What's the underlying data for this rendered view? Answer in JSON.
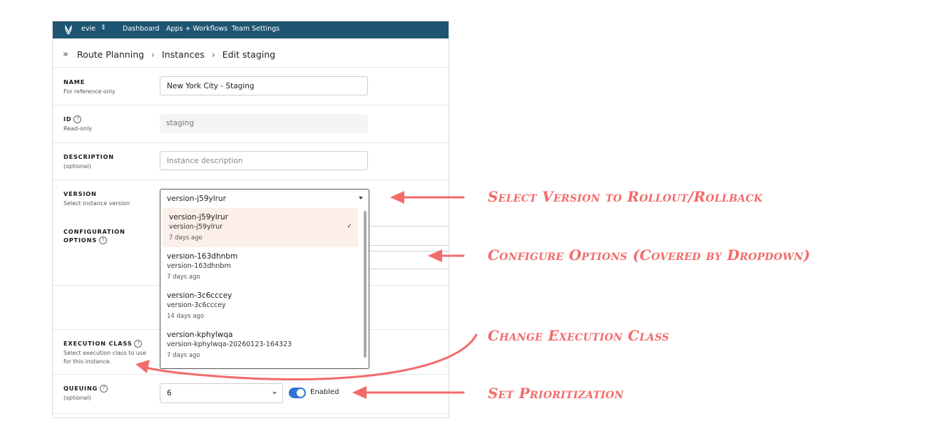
{
  "topbar": {
    "team": "evie",
    "nav": [
      "Dashboard",
      "Apps + Workflows",
      "Team Settings"
    ]
  },
  "breadcrumb": [
    "Route Planning",
    "Instances",
    "Edit staging"
  ],
  "form": {
    "name": {
      "label": "NAME",
      "sub": "For reference only",
      "value": "New York City - Staging"
    },
    "id": {
      "label": "ID",
      "sub": "Read-only",
      "value": "staging"
    },
    "description": {
      "label": "DESCRIPTION",
      "sub": "(optional)",
      "placeholder": "Instance description"
    },
    "version": {
      "label": "VERSION",
      "sub": "Select instance version",
      "value": "version-j59ylrur"
    },
    "configuration": {
      "label1": "CONFIGURATION",
      "label2": "OPTIONS"
    },
    "execution_class": {
      "label": "EXECUTION CLASS",
      "sub1": "Select execution class to use",
      "sub2": "for this instance."
    },
    "queuing": {
      "label": "QUEUING",
      "sub": "(optional)",
      "value": "6",
      "toggle_label": "Enabled",
      "toggle_on": true
    }
  },
  "dropdown_options": [
    {
      "title": "version-j59ylrur",
      "id": "version-j59ylrur",
      "age": "7 days ago",
      "selected": true
    },
    {
      "title": "version-163dhnbm",
      "id": "version-163dhnbm",
      "age": "7 days ago",
      "selected": false
    },
    {
      "title": "version-3c6cccey",
      "id": "version-3c6cccey",
      "age": "14 days ago",
      "selected": false
    },
    {
      "title": "version-kphylwqa",
      "id": "version-kphylwqa-20260123-164323",
      "age": "7 days ago",
      "selected": false
    }
  ],
  "annotations": [
    "Select Version to Rollout/Rollback",
    "Configure Options (Covered by Dropdown)",
    "Change Execution Class",
    "Set Prioritization"
  ],
  "colors": {
    "topbar": "#1e5572",
    "accent": "#f26b6b",
    "toggle": "#2f74d0",
    "selected_bg": "#fcefe9"
  }
}
